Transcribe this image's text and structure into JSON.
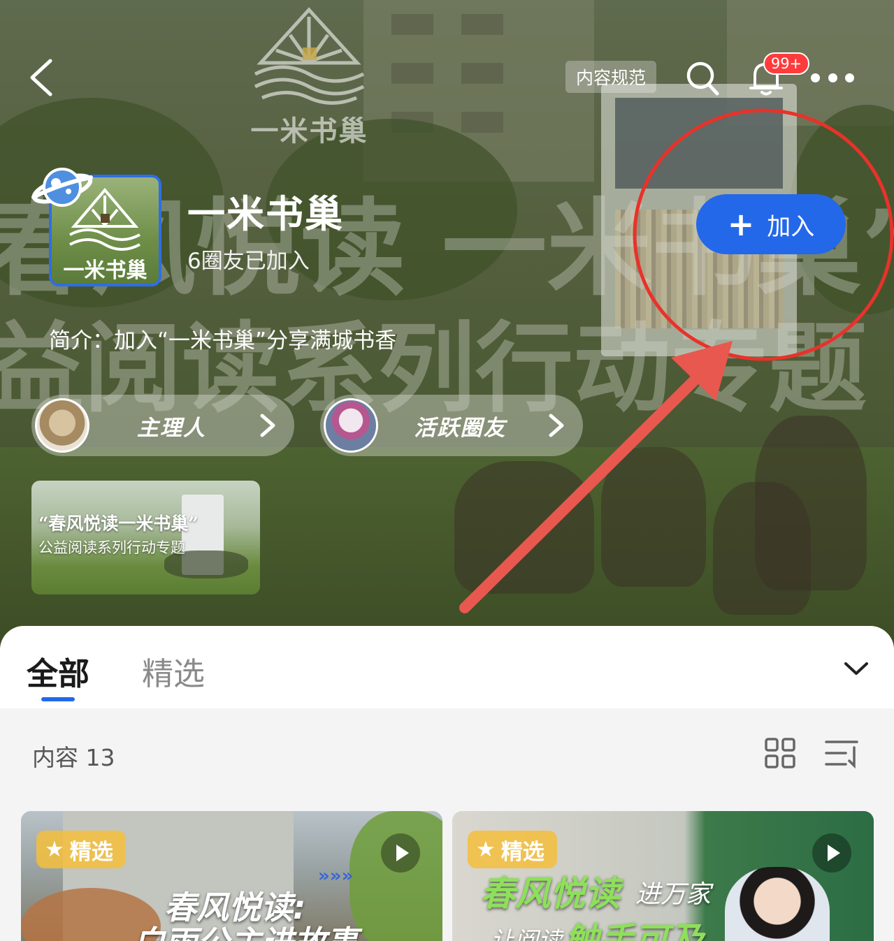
{
  "topbar": {
    "back_icon": "chevron-left-icon",
    "rules_label": "内容规范",
    "search_icon": "search-icon",
    "bell_icon": "bell-icon",
    "notification_badge": "99+",
    "more_icon": "more-dots-icon"
  },
  "hero": {
    "logo_text": "一米书巢",
    "bg_line1": "春风悦读 一米书巢”",
    "bg_line2": "益阅读系列行动专题",
    "kiosk_text": "春风悦读进万家"
  },
  "group": {
    "name": "一米书巢",
    "avatar_text": "一米书巢",
    "members": "6圈友已加入",
    "join_label": "加入",
    "intro": "简介：加入“一米书巢”分享满城书香",
    "owner_label": "主理人",
    "active_label": "活跃圈友",
    "topic_card": {
      "title": "“春风悦读一米书巢”",
      "subtitle": "公益阅读系列行动专题"
    }
  },
  "tabs": {
    "all": "全部",
    "featured": "精选",
    "expand_icon": "chevron-down-icon"
  },
  "content": {
    "count_label": "内容 13",
    "grid_icon": "grid-view-icon",
    "sort_icon": "sort-icon",
    "cards": [
      {
        "badge": "精选",
        "title": "春风悦读:",
        "title2": "白雨公主进故事"
      },
      {
        "badge": "精选",
        "title": "春风悦读",
        "title_suffix": "进万家",
        "title2_prefix": "让阅读",
        "title2": "触手可及"
      }
    ]
  },
  "colors": {
    "accent": "#2468ea",
    "annotation": "#e8322b",
    "badge": "#ff3b3b"
  }
}
